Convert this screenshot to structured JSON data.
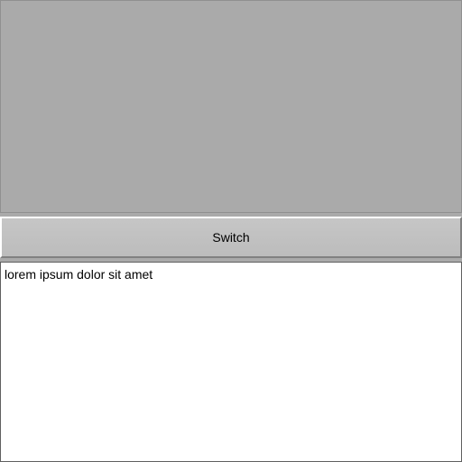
{
  "switch_button": {
    "label": "Switch"
  },
  "text_input": {
    "value": "lorem ipsum dolor sit amet"
  }
}
